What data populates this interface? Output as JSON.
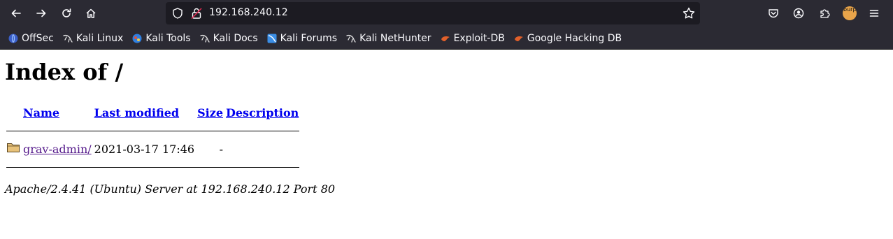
{
  "browser": {
    "url": "192.168.240.12",
    "bookmarks": [
      {
        "label": "OffSec",
        "icon": "offsec-icon"
      },
      {
        "label": "Kali Linux",
        "icon": "kali-dragon-icon"
      },
      {
        "label": "Kali Tools",
        "icon": "kali-tools-icon"
      },
      {
        "label": "Kali Docs",
        "icon": "kali-dragon-icon"
      },
      {
        "label": "Kali Forums",
        "icon": "kali-forums-icon"
      },
      {
        "label": "Kali NetHunter",
        "icon": "kali-dragon-icon"
      },
      {
        "label": "Exploit-DB",
        "icon": "exploit-db-icon"
      },
      {
        "label": "Google Hacking DB",
        "icon": "exploit-db-icon"
      }
    ],
    "extension_badge": "burp"
  },
  "page": {
    "title": "Index of /",
    "columns": {
      "name": "Name",
      "last_modified": "Last modified",
      "size": "Size",
      "description": "Description"
    },
    "rows": [
      {
        "name": "grav-admin/",
        "last_modified": "2021-03-17 17:46",
        "size": "-",
        "description": ""
      }
    ],
    "footer": "Apache/2.4.41 (Ubuntu) Server at 192.168.240.12 Port 80"
  },
  "colors": {
    "chrome_bg": "#2b2a33",
    "urlbar_bg": "#1c1b22",
    "link": "#0000ee",
    "visited_link": "#551a8b"
  }
}
